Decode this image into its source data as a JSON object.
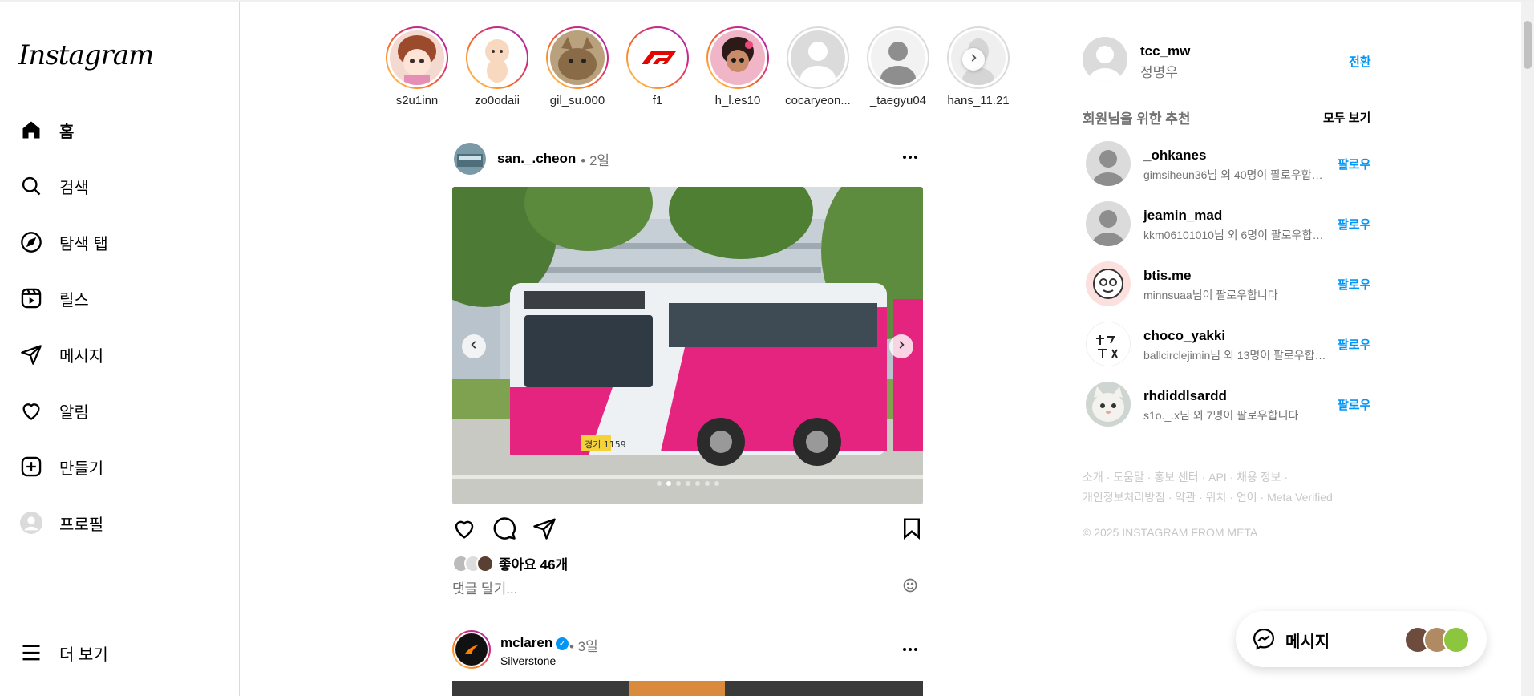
{
  "app": {
    "logo_text": "Instagram"
  },
  "sidebar": {
    "items": [
      {
        "label": "홈",
        "icon": "home-icon"
      },
      {
        "label": "검색",
        "icon": "search-icon"
      },
      {
        "label": "탐색 탭",
        "icon": "compass-icon"
      },
      {
        "label": "릴스",
        "icon": "reels-icon"
      },
      {
        "label": "메시지",
        "icon": "send-icon"
      },
      {
        "label": "알림",
        "icon": "heart-icon"
      },
      {
        "label": "만들기",
        "icon": "plus-square-icon"
      },
      {
        "label": "프로필",
        "icon": "profile-avatar"
      }
    ],
    "more_label": "더 보기"
  },
  "stories": [
    {
      "name": "s2u1inn",
      "seen": false
    },
    {
      "name": "zo0odaii",
      "seen": false
    },
    {
      "name": "gil_su.000",
      "seen": false
    },
    {
      "name": "f1",
      "seen": false
    },
    {
      "name": "h_l.es10",
      "seen": false
    },
    {
      "name": "cocaryeon...",
      "seen": true
    },
    {
      "name": "_taegyu04",
      "seen": true
    },
    {
      "name": "hans_11.21",
      "seen": true
    }
  ],
  "post": {
    "user": "san._.cheon",
    "time": "• 2일",
    "likes": "좋아요 46개",
    "comment_placeholder": "댓글 달기...",
    "carousel": {
      "count": 7,
      "active": 1
    },
    "bus_plate": "경기 1159"
  },
  "post2": {
    "user": "mclaren",
    "time": "• 3일",
    "location": "Silverstone"
  },
  "me": {
    "username": "tcc_mw",
    "name": "정명우",
    "switch_label": "전환"
  },
  "suggestions": {
    "title": "회원님을 위한 추천",
    "see_all": "모두 보기",
    "follow_label": "팔로우",
    "items": [
      {
        "name": "_ohkanes",
        "sub": "gimsiheun36님 외 40명이 팔로우합니다"
      },
      {
        "name": "jeamin_mad",
        "sub": "kkm06101010님 외 6명이 팔로우합니다"
      },
      {
        "name": "btis.me",
        "sub": "minnsuaa님이 팔로우합니다"
      },
      {
        "name": "choco_yakki",
        "sub": "ballcirclejimin님 외 13명이 팔로우합니다"
      },
      {
        "name": "rhdiddlsardd",
        "sub": "s1o._.x님 외 7명이 팔로우합니다"
      }
    ]
  },
  "footer": {
    "links_line1": "소개 · 도움말 · 홍보 센터 · API · 채용 정보 ·",
    "links_line2": "개인정보처리방침 · 약관 · 위치 · 언어 · Meta Verified",
    "copyright": "© 2025 INSTAGRAM FROM META"
  },
  "messages_bar": {
    "label": "메시지"
  },
  "colors": {
    "accent": "#0095f6",
    "story_ring": "#d62976",
    "bus_pink": "#e5247f"
  }
}
